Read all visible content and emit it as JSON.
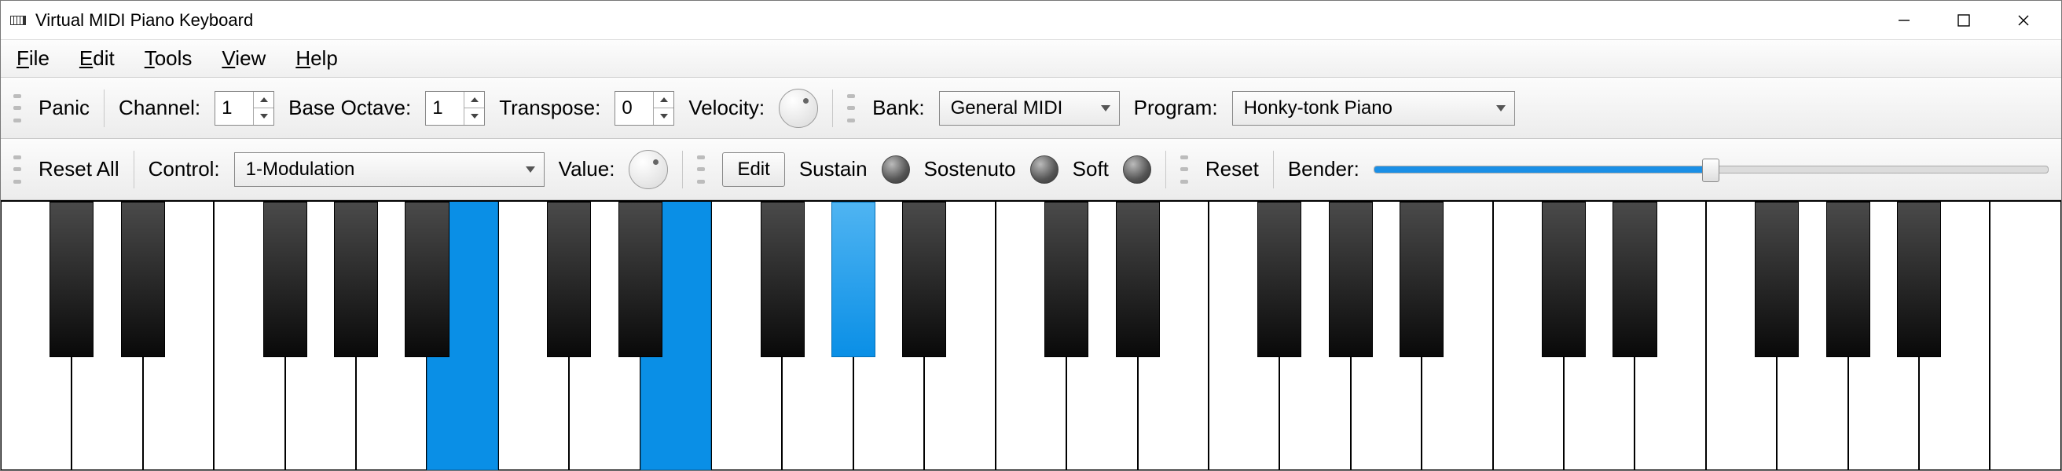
{
  "window": {
    "title": "Virtual MIDI Piano Keyboard"
  },
  "menu": {
    "file": "File",
    "edit": "Edit",
    "tools": "Tools",
    "view": "View",
    "help": "Help"
  },
  "toolbar1": {
    "panic": "Panic",
    "channel_label": "Channel:",
    "channel_value": "1",
    "base_octave_label": "Base Octave:",
    "base_octave_value": "1",
    "transpose_label": "Transpose:",
    "transpose_value": "0",
    "velocity_label": "Velocity:",
    "bank_label": "Bank:",
    "bank_value": "General MIDI",
    "program_label": "Program:",
    "program_value": "Honky-tonk Piano"
  },
  "toolbar2": {
    "reset_all": "Reset All",
    "control_label": "Control:",
    "control_value": "1-Modulation",
    "value_label": "Value:",
    "edit": "Edit",
    "sustain": "Sustain",
    "sostenuto": "Sostenuto",
    "soft": "Soft",
    "reset": "Reset",
    "bender": "Bender:"
  },
  "piano": {
    "white_key_count": 29,
    "pressed_white": [
      6,
      9
    ],
    "black_pattern": [
      1,
      1,
      0,
      1,
      1,
      1,
      0
    ],
    "pressed_black": [
      8
    ]
  }
}
